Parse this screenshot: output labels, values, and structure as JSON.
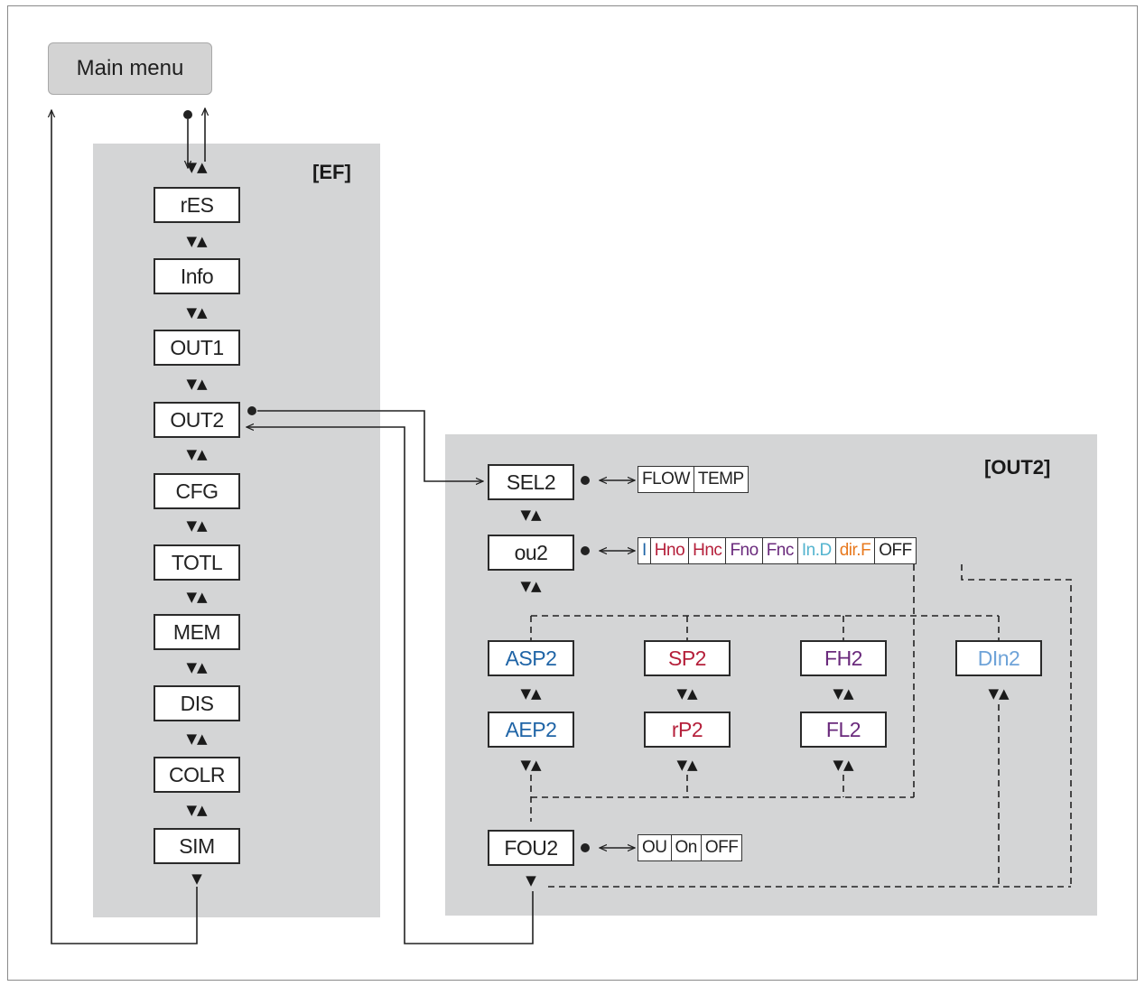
{
  "main_menu": {
    "label": "Main menu"
  },
  "ef": {
    "title": "[EF]",
    "items": [
      "rES",
      "Info",
      "OUT1",
      "OUT2",
      "CFG",
      "TOTL",
      "MEM",
      "DIS",
      "COLR",
      "SIM"
    ]
  },
  "out2": {
    "title": "[OUT2]",
    "sel2": {
      "label": "SEL2",
      "options": [
        {
          "text": "FLOW",
          "color": "#222222"
        },
        {
          "text": "TEMP",
          "color": "#222222"
        }
      ]
    },
    "ou2": {
      "label": "ou2",
      "options": [
        {
          "text": "I",
          "color": "#1f64a6"
        },
        {
          "text": "Hno",
          "color": "#b5203b"
        },
        {
          "text": "Hnc",
          "color": "#b5203b"
        },
        {
          "text": "Fno",
          "color": "#6a2a7c"
        },
        {
          "text": "Fnc",
          "color": "#6a2a7c"
        },
        {
          "text": "In.D",
          "color": "#54b4cf"
        },
        {
          "text": "dir.F",
          "color": "#e8791e"
        },
        {
          "text": "OFF",
          "color": "#222222"
        }
      ]
    },
    "asp2": {
      "label": "ASP2",
      "color": "#1f64a6"
    },
    "aep2": {
      "label": "AEP2",
      "color": "#1f64a6"
    },
    "sp2": {
      "label": "SP2",
      "color": "#b5203b"
    },
    "rp2": {
      "label": "rP2",
      "color": "#b5203b"
    },
    "fh2": {
      "label": "FH2",
      "color": "#6a2a7c"
    },
    "fl2": {
      "label": "FL2",
      "color": "#6a2a7c"
    },
    "din2": {
      "label": "DIn2",
      "color": "#6ea3d8"
    },
    "fou2": {
      "label": "FOU2",
      "options": [
        {
          "text": "OU",
          "color": "#222222"
        },
        {
          "text": "On",
          "color": "#222222"
        },
        {
          "text": "OFF",
          "color": "#222222"
        }
      ]
    }
  }
}
